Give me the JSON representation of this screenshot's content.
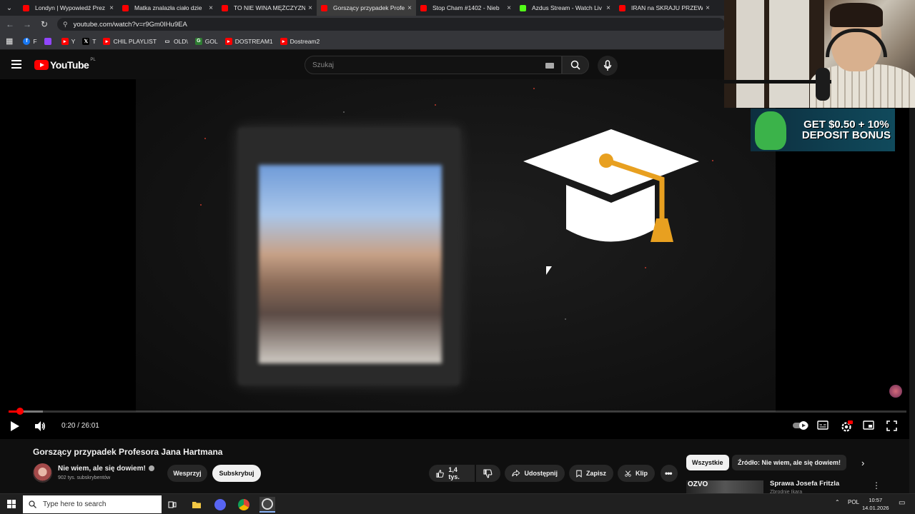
{
  "browser": {
    "tabs": [
      {
        "title": "Londyn | Wypowiedź Prez",
        "favicon_color": "#ff0000",
        "active": false
      },
      {
        "title": "Matka znalazła ciało dzie",
        "favicon_color": "#ff0000",
        "active": false
      },
      {
        "title": "TO NIE WINA MĘŻCZYZN",
        "favicon_color": "#ff0000",
        "active": false
      },
      {
        "title": "Gorszący przypadek Profe",
        "favicon_color": "#ff0000",
        "active": true
      },
      {
        "title": "Stop Cham #1402 - Nieb",
        "favicon_color": "#ff0000",
        "active": false
      },
      {
        "title": "Azdus Stream - Watch Liv",
        "favicon_color": "#53fc18",
        "active": false
      },
      {
        "title": "IRAN na SKRAJU PRZEW",
        "favicon_color": "#ff0000",
        "active": false
      }
    ],
    "close_glyph": "×",
    "url": "youtube.com/watch?v=r9Gm0IHu9EA",
    "bookmarks": [
      {
        "label": "F",
        "icon": "facebook-icon",
        "color": "#1877f2"
      },
      {
        "label": "",
        "icon": "twitch-icon",
        "color": "#9146ff"
      },
      {
        "label": "Y",
        "icon": "youtube-icon",
        "color": "#ff0000"
      },
      {
        "label": "T",
        "icon": "x-twitter-icon",
        "color": "#000000"
      },
      {
        "label": "CHIL PLAYLIST",
        "icon": "youtube-icon",
        "color": "#ff0000"
      },
      {
        "label": "OLD\\",
        "icon": "folder-icon",
        "color": "#35363a"
      },
      {
        "label": "GOL",
        "icon": "gol-icon",
        "color": "#2e7d32"
      },
      {
        "label": "DOSTREAM1",
        "icon": "youtube-icon",
        "color": "#ff0000"
      },
      {
        "label": "Dostream2",
        "icon": "youtube-icon",
        "color": "#ff0000"
      }
    ]
  },
  "youtube": {
    "logo_text": "YouTube",
    "country_code": "PL",
    "search_placeholder": "Szukaj"
  },
  "player": {
    "time_display": "0:20 / 26:01",
    "progress_fraction": 0.0128,
    "buffered_fraction": 0.038
  },
  "overlay": {
    "ad_text_line1": "GET $0.50 + 10%",
    "ad_text_line2": "DEPOSIT BONUS"
  },
  "video_info": {
    "title": "Gorszący przypadek Profesora Jana Hartmana",
    "channel": "Nie wiem, ale się dowiem!",
    "subscribers": "902 tys. subskrybentów",
    "support_label": "Wesprzyj",
    "subscribe_label": "Subskrybuj",
    "likes": "1,4 tys.",
    "share_label": "Udostępnij",
    "save_label": "Zapisz",
    "clip_label": "Klip"
  },
  "related": {
    "chips": [
      "Wszystkie",
      "Źródło: Nie wiem, ale się dowiem!"
    ],
    "first_item_title": "Sprawa Josefa Fritzla",
    "first_item_sub": "Zbrodnie Ikara",
    "first_item_thumb_text": "ОZVO"
  },
  "taskbar": {
    "search_placeholder": "Type here to search",
    "language": "POL",
    "time": "10:57",
    "date": "14.01.2026"
  }
}
